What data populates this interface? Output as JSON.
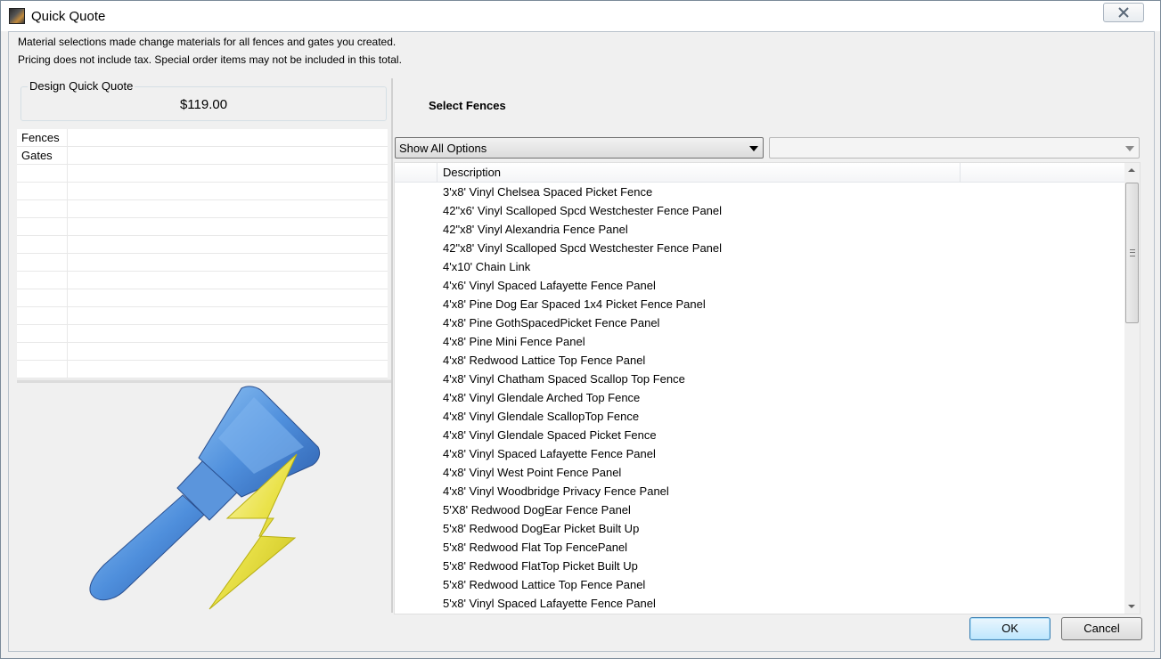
{
  "window": {
    "title": "Quick Quote"
  },
  "notes": {
    "line1": "Material selections made change materials for all fences and gates you created.",
    "line2": "Pricing does not include tax. Special order items may not be included in this total."
  },
  "design_quick_quote": {
    "legend": "Design Quick Quote",
    "total": "$119.00"
  },
  "summary_grid": {
    "rows": [
      "Fences",
      "Gates",
      "",
      "",
      "",
      "",
      "",
      "",
      "",
      "",
      "",
      "",
      "",
      ""
    ]
  },
  "select_fences": {
    "title": "Select Fences",
    "filter_value": "Show All Options",
    "secondary_value": "",
    "column_header": "Description",
    "items": [
      "3'x8' Vinyl Chelsea Spaced Picket Fence",
      "42\"x6' Vinyl Scalloped Spcd Westchester Fence Panel",
      "42\"x8' Vinyl Alexandria Fence Panel",
      "42\"x8' Vinyl Scalloped Spcd Westchester Fence Panel",
      "4'x10' Chain Link",
      "4'x6' Vinyl Spaced Lafayette Fence Panel",
      "4'x8' Pine Dog Ear Spaced 1x4 Picket Fence Panel",
      "4'x8' Pine GothSpacedPicket Fence Panel",
      "4'x8' Pine Mini Fence Panel",
      "4'x8' Redwood Lattice Top Fence Panel",
      "4'x8' Vinyl Chatham Spaced Scallop Top Fence",
      "4'x8' Vinyl Glendale Arched Top Fence",
      "4'x8' Vinyl Glendale ScallopTop Fence",
      "4'x8' Vinyl Glendale Spaced Picket Fence",
      "4'x8' Vinyl Spaced Lafayette Fence Panel",
      "4'x8' Vinyl West Point Fence Panel",
      "4'x8' Vinyl Woodbridge Privacy Fence Panel",
      "5'X8' Redwood DogEar Fence Panel",
      "5'x8' Redwood DogEar Picket Built Up",
      "5'x8' Redwood Flat Top FencePanel",
      "5'x8' Redwood FlatTop Picket Built Up",
      "5'x8' Redwood Lattice Top Fence Panel",
      "5'x8' Vinyl Spaced Lafayette Fence Panel"
    ],
    "scroll_position": 0.03
  },
  "buttons": {
    "ok": "OK",
    "cancel": "Cancel"
  },
  "icons": {
    "window": "fence-app-icon",
    "close": "close-icon",
    "logo": "paintbrush-lightning-logo"
  }
}
